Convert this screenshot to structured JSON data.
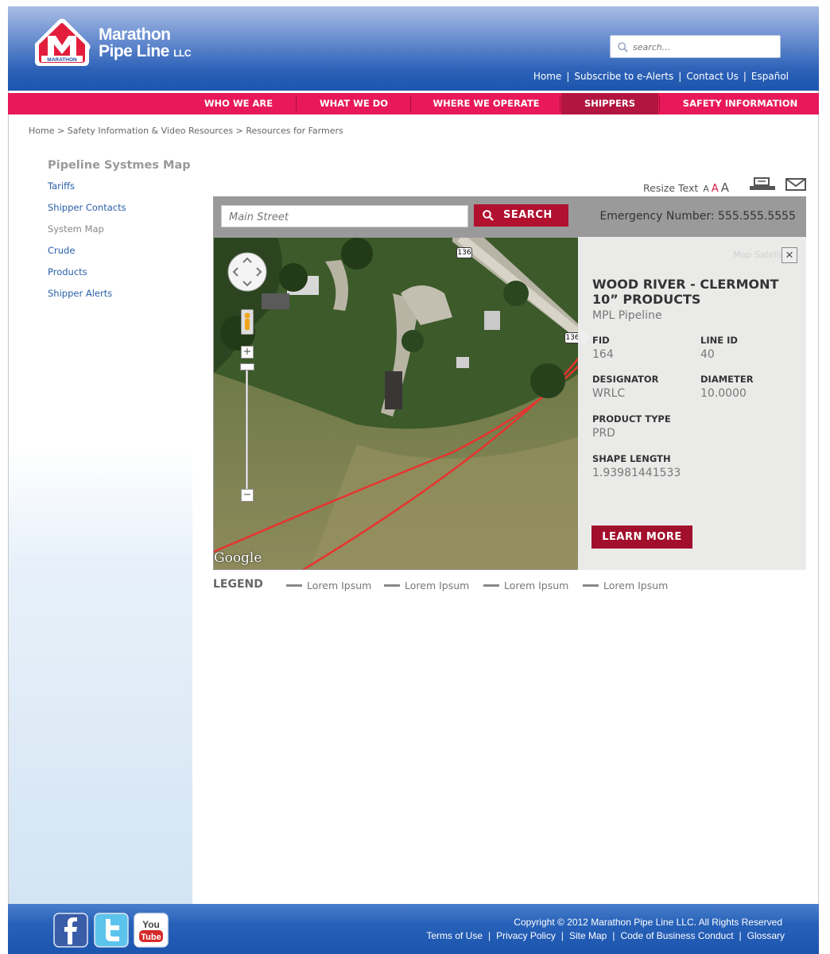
{
  "brand": {
    "badge_text": "MARATHON",
    "name_line1": "Marathon",
    "name_line2": "Pipe Line",
    "llc": "LLC",
    "colors": {
      "header_blue": "#1c55ae",
      "nav_pink": "#e8185a",
      "dark_red": "#b1102f"
    }
  },
  "header": {
    "search_placeholder": "search...",
    "links": [
      "Home",
      "Subscribe to e-Alerts",
      "Contact Us",
      "Español"
    ]
  },
  "nav": {
    "items": [
      "WHO WE ARE",
      "WHAT WE DO",
      "WHERE WE OPERATE",
      "SHIPPERS",
      "SAFETY INFORMATION"
    ],
    "active": "SHIPPERS"
  },
  "breadcrumb": "Home > Safety Information & Video Resources > Resources for Farmers",
  "sidebar": {
    "title": "Pipeline Systmes Map",
    "items": [
      "Tariffs",
      "Shipper Contacts",
      "System Map",
      "Crude",
      "Products",
      "Shipper Alerts"
    ],
    "current": "System Map"
  },
  "tools": {
    "resize_label": "Resize Text",
    "sizes": [
      "A",
      "A",
      "A"
    ],
    "print_icon": "print-icon",
    "email_icon": "email-icon"
  },
  "map_search": {
    "placeholder": "Main Street",
    "button_label": "SEARCH",
    "emergency": "Emergency Number: 555.555.5555"
  },
  "map": {
    "attribution": "Google",
    "route_shield_1": "136",
    "route_shield_2": "136",
    "faint_tabs": "Map  Satellite"
  },
  "info_panel": {
    "title": "WOOD RIVER - CLERMONT 10” PRODUCTS",
    "subtitle": "MPL Pipeline",
    "fields": {
      "fid_label": "FID",
      "fid_value": "164",
      "line_id_label": "LINE ID",
      "line_id_value": "40",
      "designator_label": "DESIGNATOR",
      "designator_value": "WRLC",
      "diameter_label": "DIAMETER",
      "diameter_value": "10.0000",
      "product_type_label": "PRODUCT TYPE",
      "product_type_value": "PRD",
      "shape_length_label": "SHAPE LENGTH",
      "shape_length_value": "1.93981441533"
    },
    "button_label": "LEARN MORE"
  },
  "legend": {
    "title": "LEGEND",
    "items": [
      "Lorem Ipsum",
      "Lorem Ipsum",
      "Lorem Ipsum",
      "Lorem Ipsum"
    ]
  },
  "footer": {
    "copyright": "Copyright © 2012 Marathon Pipe Line LLC.  All Rights Reserved",
    "links": [
      "Terms of Use",
      "Privacy Policy",
      "Site Map",
      "Code of Business Conduct",
      "Glossary"
    ],
    "social": [
      "facebook-icon",
      "twitter-icon",
      "youtube-icon"
    ],
    "youtube_text_1": "You",
    "youtube_text_2": "Tube"
  }
}
